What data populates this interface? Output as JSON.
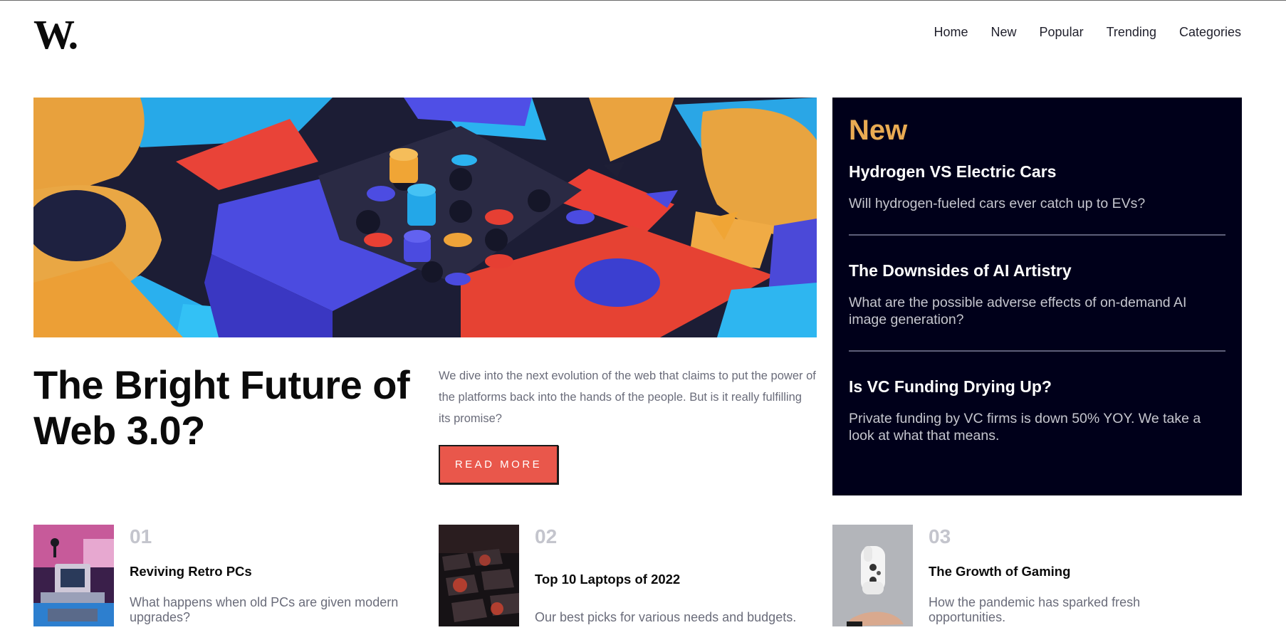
{
  "header": {
    "logo": "W.",
    "nav": [
      "Home",
      "New",
      "Popular",
      "Trending",
      "Categories"
    ]
  },
  "hero": {
    "title": "The Bright Future of Web 3.0?",
    "description": "We dive into the next evolution of the web that claims to put the power of the platforms back into the hands of the people. But is it really fulfilling its promise?",
    "button_label": "READ MORE"
  },
  "new_panel": {
    "heading": "New",
    "items": [
      {
        "title": "Hydrogen VS Electric Cars",
        "description": "Will hydrogen-fueled cars ever catch up to EVs?"
      },
      {
        "title": "The Downsides of AI Artistry",
        "description": "What are the possible adverse effects of on-demand AI image generation?"
      },
      {
        "title": "Is VC Funding Drying Up?",
        "description": "Private funding by VC firms is down 50% YOY. We take a look at what that means."
      }
    ]
  },
  "cards": [
    {
      "number": "01",
      "title": "Reviving Retro PCs",
      "description": "What happens when old PCs are given modern upgrades?"
    },
    {
      "number": "02",
      "title": "Top 10 Laptops of 2022",
      "description": "Our best picks for various needs and budgets."
    },
    {
      "number": "03",
      "title": "The Growth of Gaming",
      "description": "How the pandemic has sparked fresh opportunities."
    }
  ],
  "colors": {
    "accent_orange": "#e9ab53",
    "button_red": "#e9574b",
    "panel_navy": "#00001a",
    "muted_text": "#6a6c7a",
    "number_gray": "#c4c5cd"
  }
}
